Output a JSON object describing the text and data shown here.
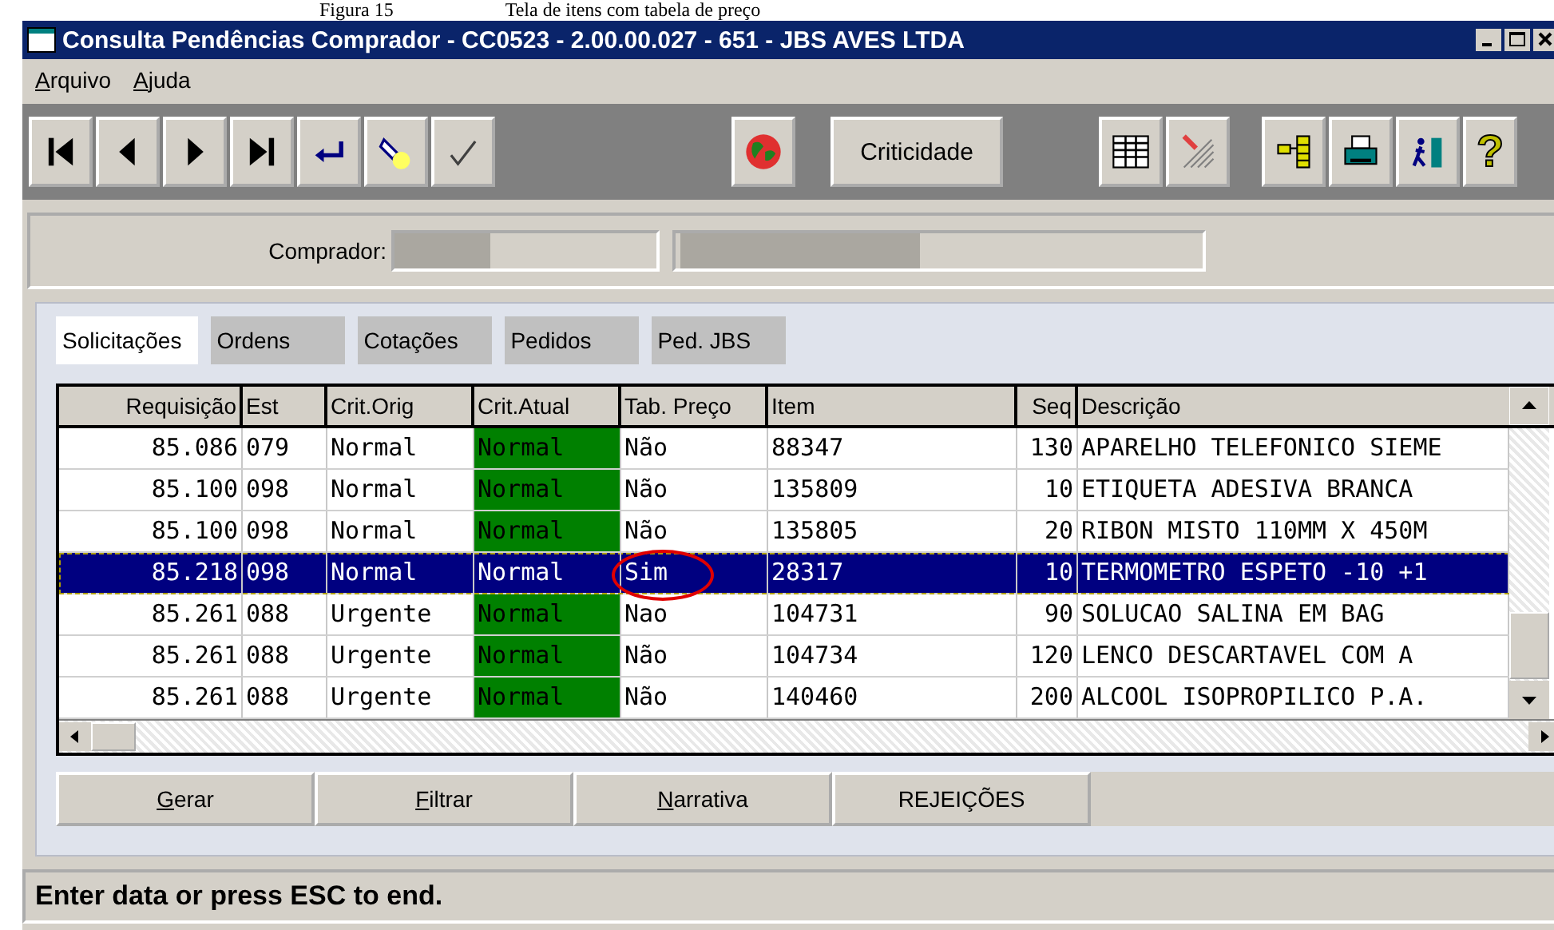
{
  "caption": {
    "figure": "Figura 15",
    "title": "Tela de itens com tabela de preço"
  },
  "window": {
    "title": "Consulta Pendências Comprador - CC0523 - 2.00.00.027 - 651 - JBS AVES LTDA"
  },
  "menu": [
    "Arquivo",
    "Ajuda"
  ],
  "toolbar": {
    "groups": [
      [
        {
          "kind": "first"
        },
        {
          "kind": "prev"
        },
        {
          "kind": "next"
        },
        {
          "kind": "last"
        },
        {
          "kind": "enter"
        },
        {
          "kind": "flashlight"
        },
        {
          "kind": "check"
        }
      ],
      [
        {
          "kind": "globe"
        }
      ],
      [
        {
          "kind": "text",
          "label": "Criticidade"
        }
      ],
      [
        {
          "kind": "grid"
        },
        {
          "kind": "pencil"
        }
      ],
      [
        {
          "kind": "tree"
        },
        {
          "kind": "printer"
        },
        {
          "kind": "exit"
        },
        {
          "kind": "help",
          "label": "?"
        }
      ]
    ]
  },
  "comprador": {
    "label": "Comprador:"
  },
  "tabs": [
    {
      "label": "Solicitações",
      "selected": true
    },
    {
      "label": "Ordens",
      "selected": false
    },
    {
      "label": "Cotações",
      "selected": false
    },
    {
      "label": "Pedidos",
      "selected": false
    },
    {
      "label": "Ped. JBS",
      "selected": false
    }
  ],
  "table": {
    "columns": [
      "Requisição",
      "Est",
      "Crit.Orig",
      "Crit.Atual",
      "Tab. Preço",
      "Item",
      "Seq",
      "Descrição"
    ],
    "rows": [
      {
        "cells": [
          "85.086",
          "079",
          "Normal",
          "Normal",
          "Não",
          "88347",
          "130",
          "APARELHO TELEFONICO SIEME"
        ],
        "color": "#008000",
        "selected": false,
        "circled": false
      },
      {
        "cells": [
          "85.100",
          "098",
          "Normal",
          "Normal",
          "Não",
          "135809",
          "10",
          "ETIQUETA ADESIVA BRANCA"
        ],
        "color": "#008000",
        "selected": false,
        "circled": false
      },
      {
        "cells": [
          "85.100",
          "098",
          "Normal",
          "Normal",
          "Não",
          "135805",
          "20",
          "RIBON MISTO 110MM X 450M"
        ],
        "color": "#008000",
        "selected": false,
        "circled": false
      },
      {
        "cells": [
          "85.218",
          "098",
          "Normal",
          "Normal",
          "Sim",
          "28317",
          "10",
          "TERMOMETRO ESPETO -10 +1"
        ],
        "selected": true,
        "circled": true
      },
      {
        "cells": [
          "85.261",
          "088",
          "Urgente",
          "Normal",
          "Nao",
          "104731",
          "90",
          "SOLUCAO SALINA EM BAG"
        ],
        "color": "#008000",
        "selected": false,
        "circled": false
      },
      {
        "cells": [
          "85.261",
          "088",
          "Urgente",
          "Normal",
          "Não",
          "104734",
          "120",
          "LENCO DESCARTAVEL COM A"
        ],
        "color": "#008000",
        "selected": false,
        "circled": false
      },
      {
        "cells": [
          "85.261",
          "088",
          "Urgente",
          "Normal",
          "Não",
          "140460",
          "200",
          "ALCOOL ISOPROPILICO P.A."
        ],
        "color": "#008000",
        "selected": false,
        "circled": false
      }
    ]
  },
  "buttons": [
    "Gerar",
    "Filtrar",
    "Narrativa",
    "REJEIÇÕES"
  ],
  "status_bar": "Enter data or press ESC to end."
}
